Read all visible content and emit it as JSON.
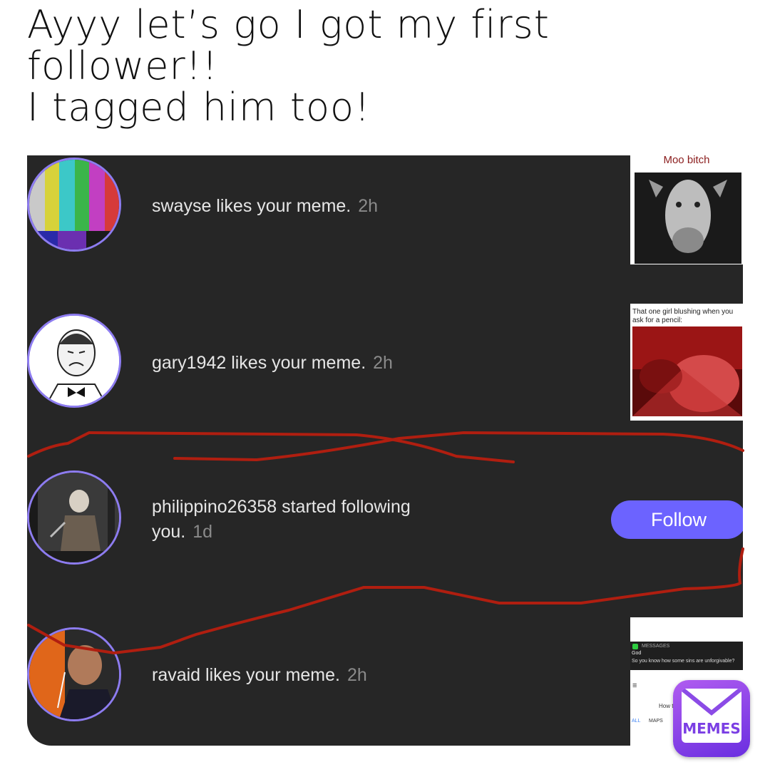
{
  "caption": {
    "line1": "Ayyy let’s go I got my first",
    "line2": "follower!!",
    "line3": "I tagged him too!"
  },
  "notifications": [
    {
      "text": "swayse likes your meme.",
      "time": "2h",
      "thumb_caption": "Moo bitch"
    },
    {
      "text": "gary1942 likes your meme.",
      "time": "2h",
      "thumb_caption": "That one girl blushing when you ask for a pencil:"
    },
    {
      "text_line1": "philippino26358 started following",
      "text_line2": "you.",
      "time": "1d",
      "button": "Follow"
    },
    {
      "text": "ravaid likes your meme.",
      "time": "2h",
      "thumb_header": "MESSAGES",
      "thumb_from": "God",
      "thumb_message": "So you know how some sins are unforgivable?",
      "thumb_search": "How to",
      "thumb_tab_all": "ALL",
      "thumb_tab_maps": "MAPS"
    }
  ],
  "watermark": {
    "label": "MEMES"
  },
  "colors": {
    "panel_bg": "#262626",
    "accent": "#6c63ff",
    "avatar_ring": "#8d7cf0",
    "scribble": "#b01e10"
  }
}
